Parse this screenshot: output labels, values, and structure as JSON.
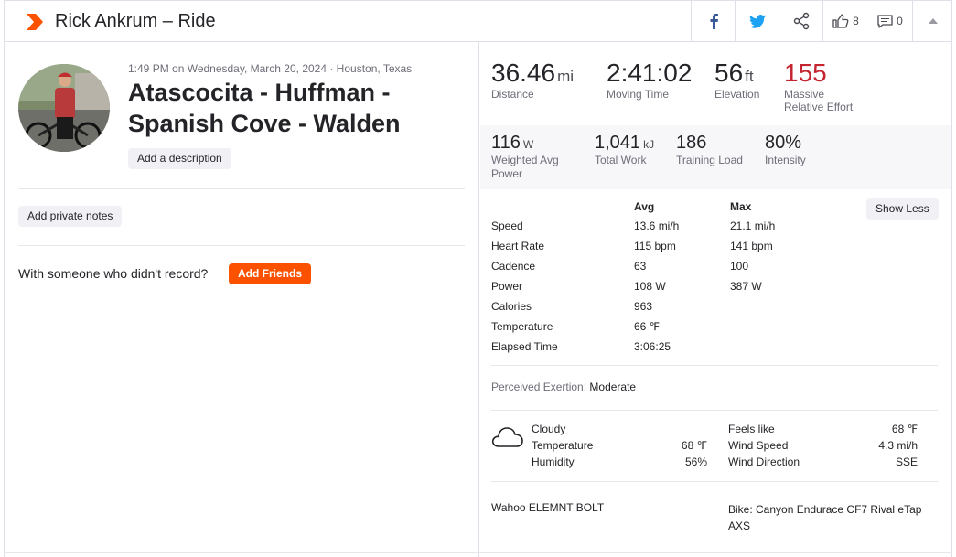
{
  "header": {
    "title": "Rick Ankrum – Ride",
    "kudos_count": "8",
    "comments_count": "0",
    "brand_color": "#fc5200",
    "icons": [
      "strava-logo-icon",
      "facebook-icon",
      "twitter-icon",
      "share-icon",
      "thumbs-up-icon",
      "comment-icon",
      "chevron-up-icon"
    ]
  },
  "activity": {
    "meta": "1:49 PM on Wednesday, March 20, 2024 · Houston, Texas",
    "title": "Atascocita - Huffman - Spanish Cove - Walden",
    "add_description": "Add a description",
    "add_private_notes": "Add private notes",
    "with_someone": "With someone who didn't record?",
    "add_friends": "Add Friends"
  },
  "stats": {
    "distance": {
      "value": "36.46",
      "unit": "mi",
      "label": "Distance"
    },
    "moving_time": {
      "value": "2:41:02",
      "label": "Moving Time"
    },
    "elevation": {
      "value": "56",
      "unit": "ft",
      "label": "Elevation"
    },
    "relative_effort": {
      "value": "155",
      "label_line1": "Massive",
      "label_line2": "Relative Effort",
      "color": "#c42530"
    }
  },
  "secondary": {
    "power": {
      "value": "116",
      "unit": "W",
      "label_line1": "Weighted Avg",
      "label_line2": "Power"
    },
    "work": {
      "value": "1,041",
      "unit": "kJ",
      "label": "Total Work"
    },
    "training_load": {
      "value": "186",
      "label": "Training Load"
    },
    "intensity": {
      "value": "80%",
      "label": "Intensity"
    }
  },
  "table": {
    "avg_header": "Avg",
    "max_header": "Max",
    "show_less": "Show Less",
    "rows": [
      {
        "label": "Speed",
        "avg": "13.6 mi/h",
        "max": "21.1 mi/h"
      },
      {
        "label": "Heart Rate",
        "avg": "115 bpm",
        "max": "141 bpm"
      },
      {
        "label": "Cadence",
        "avg": "63",
        "max": "100"
      },
      {
        "label": "Power",
        "avg": "108 W",
        "max": "387 W"
      },
      {
        "label": "Calories",
        "avg": "963",
        "max": ""
      },
      {
        "label": "Temperature",
        "avg": "66 ℉",
        "max": ""
      },
      {
        "label": "Elapsed Time",
        "avg": "3:06:25",
        "max": ""
      }
    ]
  },
  "exertion": {
    "label": "Perceived Exertion:",
    "value": "Moderate"
  },
  "weather": {
    "condition": "Cloudy",
    "temperature_label": "Temperature",
    "temperature_value": "68 ℉",
    "humidity_label": "Humidity",
    "humidity_value": "56%",
    "feels_like_label": "Feels like",
    "feels_like_value": "68 ℉",
    "wind_speed_label": "Wind Speed",
    "wind_speed_value": "4.3 mi/h",
    "wind_direction_label": "Wind Direction",
    "wind_direction_value": "SSE"
  },
  "gear": {
    "device": "Wahoo ELEMNT BOLT",
    "bike": "Bike: Canyon Endurace CF7 Rival eTap AXS"
  }
}
